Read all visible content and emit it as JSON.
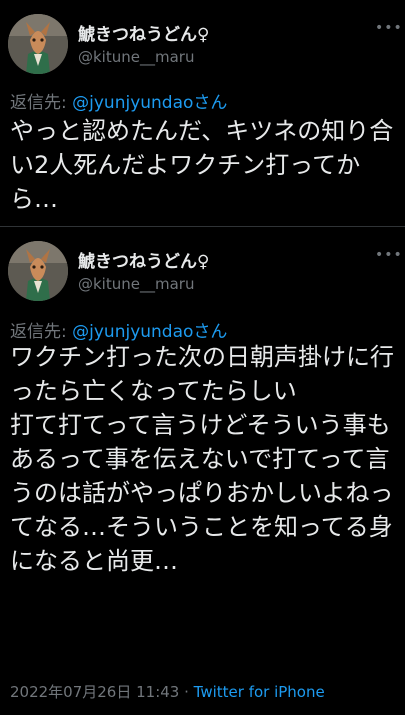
{
  "tweets": [
    {
      "display_name": "鯱きつねうどん♀",
      "handle": "@kitune__maru",
      "more_label": "•••",
      "reply_prefix": "返信先: ",
      "reply_mention": "@jyunjyundaoさん",
      "text": "やっと認めたんだ、キツネの知り合い2人死んだよワクチン打ってから…"
    },
    {
      "display_name": "鯱きつねうどん♀",
      "handle": "@kitune__maru",
      "more_label": "•••",
      "reply_prefix": "返信先: ",
      "reply_mention": "@jyunjyundaoさん",
      "text": "ワクチン打った次の日朝声掛けに行ったら亡くなってたらしい\n打て打てって言うけどそういう事もあるって事を伝えないで打てって言うのは話がやっぱりおかしいよねってなる…そういうことを知ってる身になると尚更…",
      "timestamp": "2022年07月26日 11:43",
      "separator": " · ",
      "source": "Twitter for iPhone"
    }
  ],
  "colors": {
    "background": "#000000",
    "text": "#e7e9ea",
    "secondary": "#71767b",
    "link": "#1d9bf0",
    "divider": "#2f3336"
  },
  "icons": {
    "avatar": "fox-character-avatar",
    "more": "more-options-icon"
  }
}
